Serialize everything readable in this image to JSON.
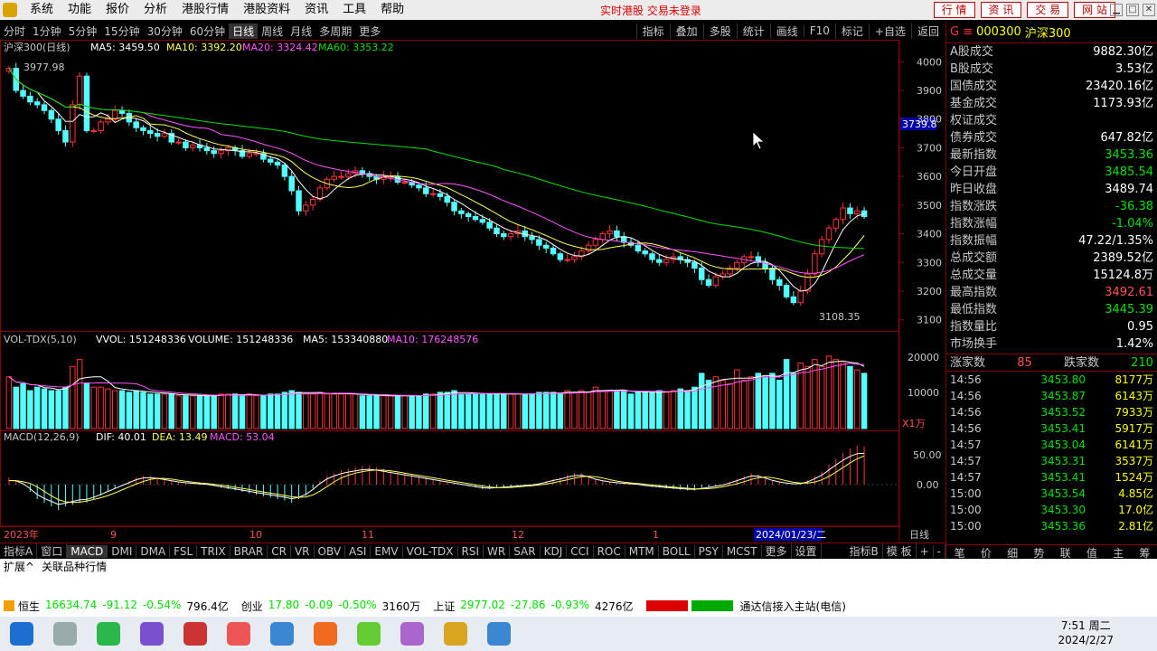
{
  "menu": {
    "items": [
      "系统",
      "功能",
      "报价",
      "分析",
      "港股行情",
      "港股资料",
      "资讯",
      "工具",
      "帮助"
    ],
    "status": "实时港股 交易未登录",
    "right_buttons": [
      "行 情",
      "资 讯",
      "交 易",
      "网 站"
    ]
  },
  "periods": [
    "分时",
    "1分钟",
    "5分钟",
    "15分钟",
    "30分钟",
    "60分钟",
    "日线",
    "周线",
    "月线",
    "多周期",
    "更多"
  ],
  "active_period": "日线",
  "tools": [
    "指标",
    "叠加",
    "多股",
    "统计",
    "画线",
    "F10",
    "标记",
    "+自选",
    "返回"
  ],
  "main_chart": {
    "title": "沪深300(日线)",
    "ma_labels": {
      "ma5": "MA5: 3459.50",
      "ma10": "MA10: 3392.20",
      "ma20": "MA20: 3324.42",
      "ma60": "MA60: 3353.22"
    },
    "high_label": "3977.98",
    "low_label": "3108.35",
    "cursor_price": "3739.8",
    "y_ticks": [
      "4000",
      "3900",
      "3800",
      "3700",
      "3600",
      "3500",
      "3400",
      "3300",
      "3200",
      "3100"
    ]
  },
  "volume_chart": {
    "label": "VOL-TDX(5,10)",
    "vvol": "VVOL: 151248336",
    "volume": "VOLUME: 151248336",
    "ma5": "MA5: 153340880",
    "ma10": "MA10: 176248576",
    "y_ticks": [
      "20000",
      "10000"
    ],
    "unit": "X1万"
  },
  "macd_chart": {
    "label": "MACD(12,26,9)",
    "dif": "DIF: 40.01",
    "dea": "DEA: 13.49",
    "macd": "MACD: 53.04",
    "y_ticks": [
      "50.00",
      "0.00"
    ]
  },
  "x_axis": {
    "labels": [
      "2023年",
      "9",
      "10",
      "11",
      "12",
      "1"
    ],
    "current": "2024/01/23/二",
    "period_label": "日线"
  },
  "chart_data": {
    "type": "candlestick",
    "title": "沪深300(日线)",
    "ylim": [
      3080,
      4020
    ],
    "high": 3977.98,
    "low": 3108.35,
    "closes": [
      3977,
      3900,
      3880,
      3860,
      3850,
      3830,
      3800,
      3760,
      3720,
      3850,
      3950,
      3760,
      3760,
      3790,
      3800,
      3830,
      3820,
      3790,
      3770,
      3760,
      3750,
      3740,
      3750,
      3720,
      3720,
      3700,
      3710,
      3700,
      3690,
      3680,
      3690,
      3700,
      3690,
      3670,
      3680,
      3680,
      3660,
      3650,
      3640,
      3600,
      3550,
      3480,
      3500,
      3520,
      3560,
      3590,
      3600,
      3600,
      3610,
      3620,
      3610,
      3600,
      3590,
      3600,
      3600,
      3580,
      3580,
      3570,
      3560,
      3540,
      3540,
      3530,
      3510,
      3480,
      3470,
      3460,
      3450,
      3440,
      3420,
      3400,
      3390,
      3400,
      3410,
      3390,
      3380,
      3360,
      3350,
      3330,
      3310,
      3310,
      3320,
      3340,
      3360,
      3380,
      3400,
      3410,
      3390,
      3370,
      3360,
      3340,
      3330,
      3310,
      3300,
      3310,
      3320,
      3310,
      3300,
      3280,
      3240,
      3220,
      3250,
      3260,
      3280,
      3300,
      3320,
      3320,
      3300,
      3280,
      3240,
      3220,
      3180,
      3160,
      3200,
      3260,
      3330,
      3380,
      3420,
      3450,
      3490,
      3470,
      3480,
      3460
    ],
    "volume": [
      15000,
      12000,
      13000,
      11000,
      12000,
      11500,
      11000,
      11000,
      12000,
      18000,
      20000,
      13000,
      12000,
      12000,
      11500,
      11000,
      11000,
      10500,
      11000,
      10500,
      10000,
      10000,
      10000,
      10000,
      9500,
      9500,
      9500,
      9500,
      9500,
      9500,
      10000,
      10000,
      10000,
      9500,
      10000,
      9500,
      9500,
      10000,
      10000,
      10500,
      11000,
      10500,
      10000,
      10000,
      10500,
      10000,
      10000,
      10000,
      10000,
      10000,
      9500,
      9500,
      9500,
      9500,
      9500,
      9500,
      9500,
      9500,
      9500,
      10000,
      10000,
      10500,
      10500,
      11000,
      10000,
      10000,
      10000,
      10000,
      10000,
      10000,
      10000,
      10000,
      10000,
      10000,
      10000,
      10500,
      10500,
      10500,
      10000,
      11000,
      10500,
      11000,
      10500,
      12000,
      11000,
      11000,
      11000,
      11000,
      10000,
      10500,
      10500,
      10500,
      11000,
      10500,
      11000,
      11500,
      11000,
      12000,
      16000,
      14000,
      15000,
      14000,
      13000,
      17000,
      14000,
      15000,
      16000,
      15000,
      16000,
      14000,
      20000,
      16000,
      19000,
      18000,
      20000,
      18000,
      21000,
      20000,
      19000,
      18000,
      17000,
      16000
    ],
    "macd": [
      10,
      5,
      0,
      -10,
      -20,
      -25,
      -30,
      -35,
      -30,
      -28,
      -25,
      -25,
      -20,
      -15,
      -10,
      -5,
      0,
      5,
      10,
      12,
      12,
      10,
      8,
      6,
      4,
      3,
      2,
      1,
      0,
      -2,
      -4,
      -6,
      -8,
      -10,
      -12,
      -14,
      -16,
      -18,
      -20,
      -22,
      -25,
      -20,
      -15,
      -5,
      5,
      12,
      16,
      20,
      22,
      24,
      26,
      26,
      24,
      22,
      20,
      18,
      16,
      14,
      12,
      10,
      8,
      6,
      4,
      2,
      0,
      -2,
      -4,
      -6,
      -6,
      -5,
      -4,
      -3,
      -2,
      -1,
      0,
      2,
      5,
      8,
      10,
      14,
      16,
      16,
      12,
      8,
      6,
      4,
      3,
      2,
      1,
      0,
      -2,
      -3,
      -4,
      -5,
      -6,
      -7,
      -8,
      -8,
      -6,
      -4,
      -2,
      0,
      4,
      8,
      12,
      16,
      14,
      10,
      6,
      4,
      2,
      1,
      2,
      6,
      12,
      18,
      28,
      36,
      44,
      50,
      54,
      53
    ]
  },
  "right_panel": {
    "code": "000300",
    "name": "沪深300",
    "stats": [
      {
        "label": "A股成交",
        "value": "9882.30亿",
        "color": "white"
      },
      {
        "label": "B股成交",
        "value": "3.53亿",
        "color": "white"
      },
      {
        "label": "国债成交",
        "value": "23420.16亿",
        "color": "white"
      },
      {
        "label": "基金成交",
        "value": "1173.93亿",
        "color": "white"
      },
      {
        "label": "权证成交",
        "value": "",
        "color": "white"
      },
      {
        "label": "债券成交",
        "value": "647.82亿",
        "color": "white"
      },
      {
        "label": "最新指数",
        "value": "3453.36",
        "color": "green"
      },
      {
        "label": "今日开盘",
        "value": "3485.54",
        "color": "green"
      },
      {
        "label": "昨日收盘",
        "value": "3489.74",
        "color": "white"
      },
      {
        "label": "指数涨跌",
        "value": "-36.38",
        "color": "green"
      },
      {
        "label": "指数涨幅",
        "value": "-1.04%",
        "color": "green"
      },
      {
        "label": "指数振幅",
        "value": "47.22/1.35%",
        "color": "white"
      },
      {
        "label": "总成交额",
        "value": "2389.52亿",
        "color": "white"
      },
      {
        "label": "总成交量",
        "value": "15124.8万",
        "color": "white"
      },
      {
        "label": "最高指数",
        "value": "3492.61",
        "color": "red"
      },
      {
        "label": "最低指数",
        "value": "3445.39",
        "color": "green"
      },
      {
        "label": "指数量比",
        "value": "0.95",
        "color": "white"
      },
      {
        "label": "市场换手",
        "value": "1.42%",
        "color": "white"
      }
    ],
    "up_label": "涨家数",
    "up_count": "85",
    "down_label": "跌家数",
    "down_count": "210",
    "ticks": [
      {
        "t": "14:56",
        "p": "3453.80",
        "v": "8177万"
      },
      {
        "t": "14:56",
        "p": "3453.87",
        "v": "6143万"
      },
      {
        "t": "14:56",
        "p": "3453.52",
        "v": "7933万"
      },
      {
        "t": "14:56",
        "p": "3453.41",
        "v": "5917万"
      },
      {
        "t": "14:57",
        "p": "3453.04",
        "v": "6141万"
      },
      {
        "t": "14:57",
        "p": "3453.31",
        "v": "3537万"
      },
      {
        "t": "14:57",
        "p": "3453.41",
        "v": "1524万"
      },
      {
        "t": "15:00",
        "p": "3453.54",
        "v": "4.85亿"
      },
      {
        "t": "15:00",
        "p": "3453.30",
        "v": "17.0亿"
      },
      {
        "t": "15:00",
        "p": "3453.36",
        "v": "2.81亿"
      }
    ],
    "tabs": [
      "笔",
      "价",
      "细",
      "势",
      "联",
      "值",
      "主",
      "筹"
    ]
  },
  "indicator_tabs": [
    "指标A",
    "窗口",
    "MACD",
    "DMI",
    "DMA",
    "FSL",
    "TRIX",
    "BRAR",
    "CR",
    "VR",
    "OBV",
    "ASI",
    "EMV",
    "VOL-TDX",
    "RSI",
    "WR",
    "SAR",
    "KDJ",
    "CCI",
    "ROC",
    "MTM",
    "BOLL",
    "PSY",
    "MCST",
    "更多",
    "设置"
  ],
  "indicator_right": [
    "指标B",
    "模 板",
    "+",
    "-"
  ],
  "ext_bar": [
    "扩展^",
    "关联品种行情"
  ],
  "ticker": {
    "hsi": {
      "name": "恒生",
      "value": "16634.74",
      "chg": "-91.12",
      "pct": "-0.54%",
      "amt": "796.4亿"
    },
    "cyb": {
      "name": "创业",
      "value": "17.80",
      "chg": "-0.09",
      "pct": "-0.50%",
      "amt": "3160万"
    },
    "sh": {
      "name": "上证",
      "value": "2977.02",
      "chg": "-27.86",
      "pct": "-0.93%",
      "amt": "4276亿"
    },
    "conn": "通达信接入主站(电信)"
  },
  "clock": {
    "time": "7:51 周二",
    "date": "2024/2/27"
  }
}
